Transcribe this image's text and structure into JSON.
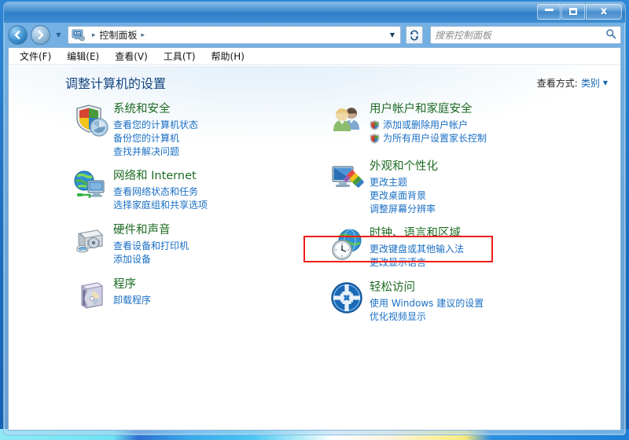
{
  "window": {
    "title": "",
    "controls": {
      "minimize": "最小化",
      "maximize": "最大化",
      "close": "关闭"
    }
  },
  "nav": {
    "back": "后退",
    "forward": "前进",
    "history_dropdown": "▼",
    "breadcrumb_icon": "control-panel-icon",
    "breadcrumb": "控制面板",
    "separator": "▸",
    "address_dropdown": "▼",
    "refresh": "刷新"
  },
  "search": {
    "placeholder": "搜索控制面板",
    "value": "",
    "icon": "search-icon"
  },
  "menubar": {
    "items": [
      {
        "label": "文件(F)"
      },
      {
        "label": "编辑(E)"
      },
      {
        "label": "查看(V)"
      },
      {
        "label": "工具(T)"
      },
      {
        "label": "帮助(H)"
      }
    ]
  },
  "page": {
    "title": "调整计算机的设置",
    "viewby_label": "查看方式:",
    "viewby_value": "类别",
    "viewby_caret": "▼"
  },
  "categories": {
    "left": [
      {
        "title": "系统和安全",
        "icon": "security-shield-icon",
        "links": [
          {
            "label": "查看您的计算机状态",
            "shield": false
          },
          {
            "label": "备份您的计算机",
            "shield": false
          },
          {
            "label": "查找并解决问题",
            "shield": false
          }
        ]
      },
      {
        "title": "网络和 Internet",
        "icon": "network-globe-icon",
        "links": [
          {
            "label": "查看网络状态和任务",
            "shield": false
          },
          {
            "label": "选择家庭组和共享选项",
            "shield": false
          }
        ]
      },
      {
        "title": "硬件和声音",
        "icon": "printer-device-icon",
        "links": [
          {
            "label": "查看设备和打印机",
            "shield": false
          },
          {
            "label": "添加设备",
            "shield": false
          }
        ]
      },
      {
        "title": "程序",
        "icon": "programs-box-icon",
        "links": [
          {
            "label": "卸载程序",
            "shield": false
          }
        ]
      }
    ],
    "right": [
      {
        "title": "用户帐户和家庭安全",
        "icon": "user-accounts-icon",
        "links": [
          {
            "label": "添加或删除用户帐户",
            "shield": true
          },
          {
            "label": "为所有用户设置家长控制",
            "shield": true
          }
        ]
      },
      {
        "title": "外观和个性化",
        "icon": "appearance-monitor-icon",
        "links": [
          {
            "label": "更改主题",
            "shield": false
          },
          {
            "label": "更改桌面背景",
            "shield": false
          },
          {
            "label": "调整屏幕分辨率",
            "shield": false
          }
        ]
      },
      {
        "title": "时钟、语言和区域",
        "icon": "clock-globe-icon",
        "highlighted": true,
        "links": [
          {
            "label": "更改键盘或其他输入法",
            "shield": false
          },
          {
            "label": "更改显示语言",
            "shield": false
          }
        ]
      },
      {
        "title": "轻松访问",
        "icon": "ease-of-access-icon",
        "links": [
          {
            "label": "使用 Windows 建议的设置",
            "shield": false
          },
          {
            "label": "优化视频显示",
            "shield": false
          }
        ]
      }
    ]
  },
  "annotation": {
    "type": "highlight-rectangle",
    "color": "#ee1c1c",
    "target": "时钟、语言和区域"
  }
}
